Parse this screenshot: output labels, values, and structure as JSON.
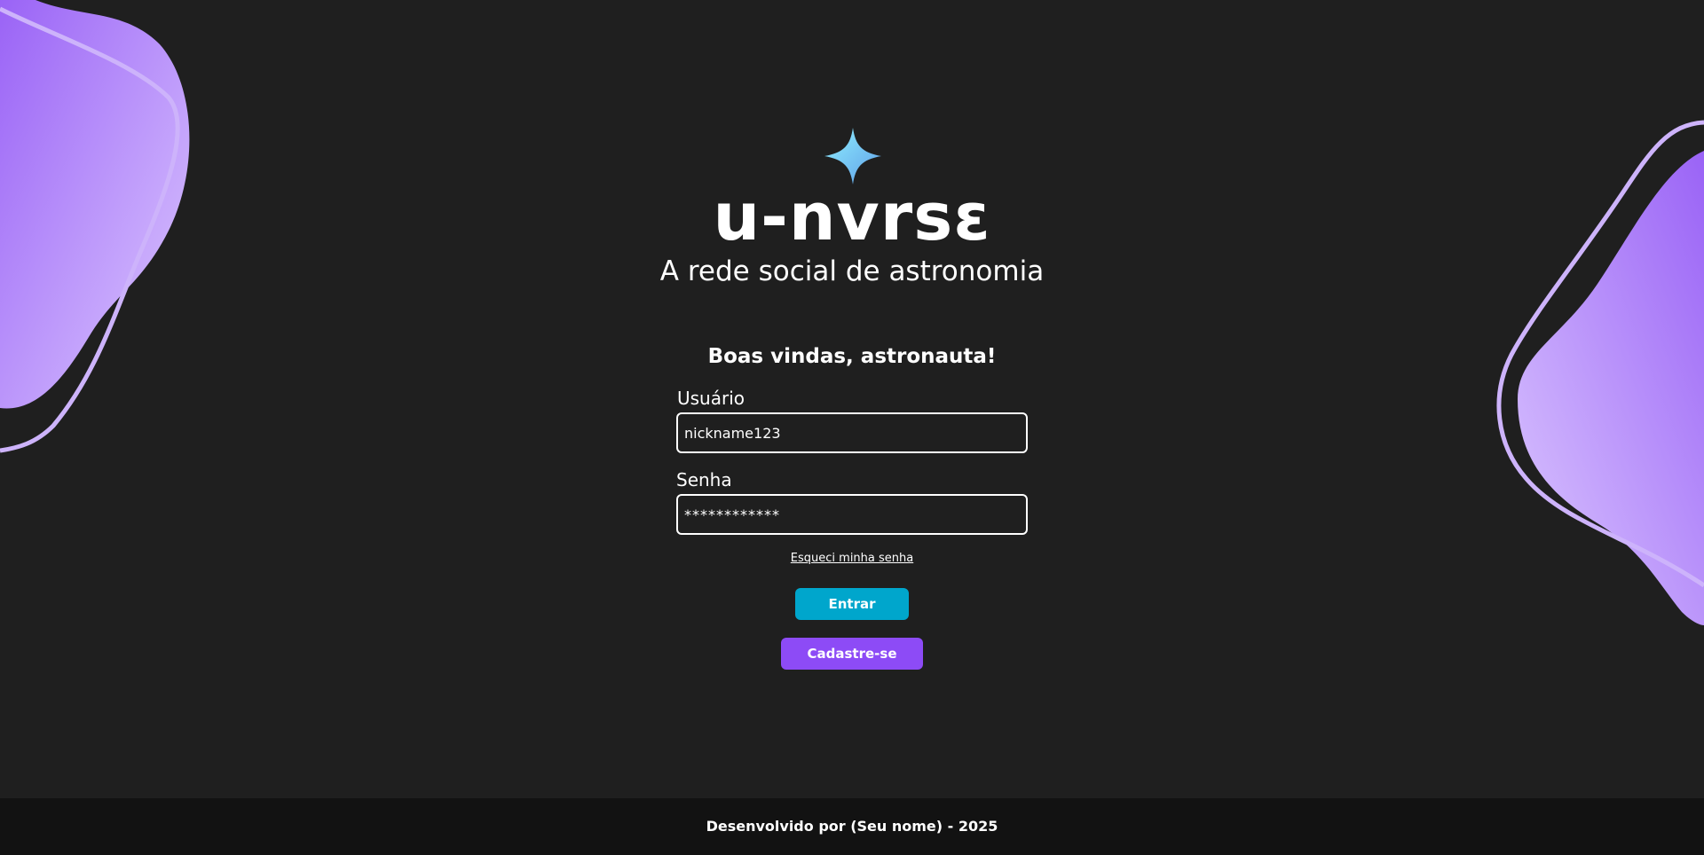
{
  "brand": {
    "logo_text": "u-nvrsɛ",
    "tagline": "A rede social de astronomia"
  },
  "login": {
    "welcome": "Boas vindas, astronauta!",
    "username_label": "Usuário",
    "username_value": "nickname123",
    "password_label": "Senha",
    "password_value": "************",
    "forgot_link": "Esqueci minha senha",
    "login_button": "Entrar",
    "signup_button": "Cadastre-se"
  },
  "footer": {
    "text": "Desenvolvido por (Seu nome) - 2025"
  },
  "icons": {
    "logo_icon": "four-point-star-icon"
  },
  "colors": {
    "background": "#1f1f1f",
    "footer_background": "#121212",
    "login_button": "#00a6cc",
    "signup_button": "#8d4bf6",
    "blob_purple": "#a97cf8",
    "star_cyan": "#7fe0f0"
  }
}
